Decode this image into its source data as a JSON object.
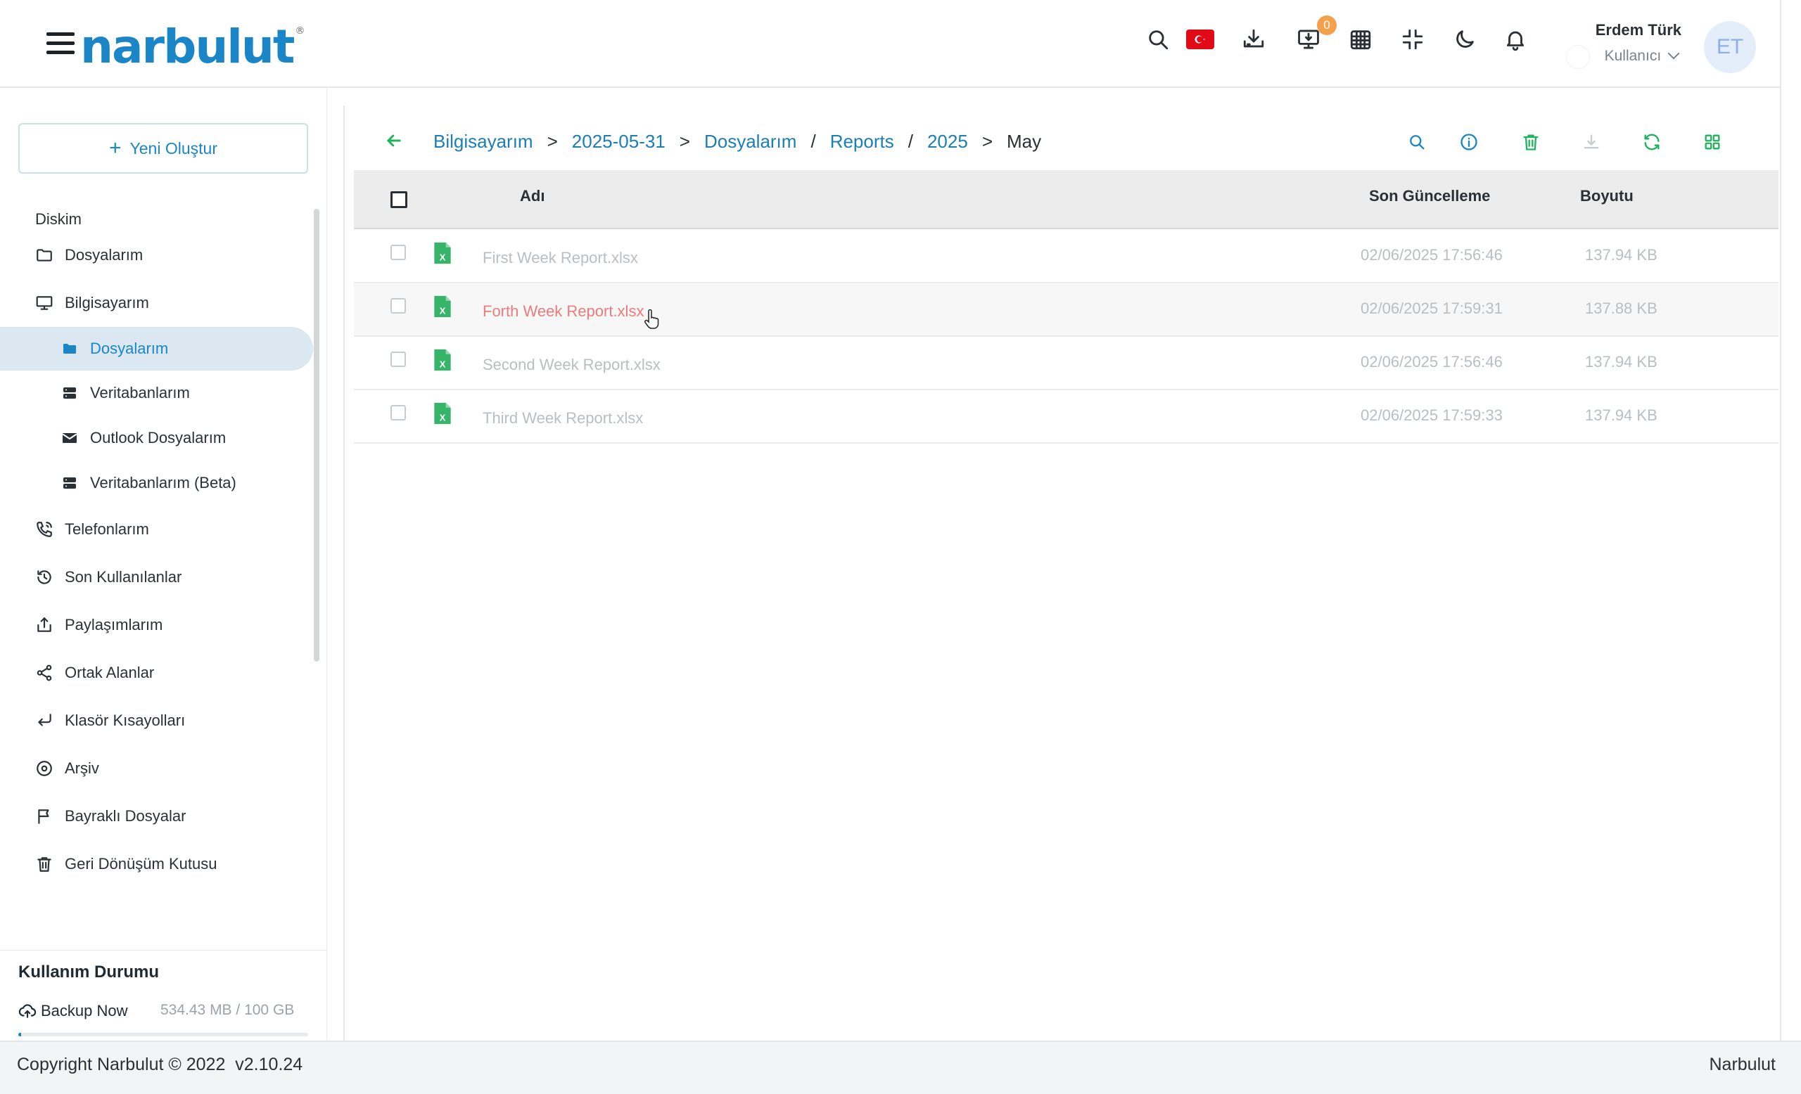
{
  "app": {
    "logo_text": "narbulut",
    "logo_mark": "®"
  },
  "header": {
    "icons": [
      "search-icon",
      "turkish-flag-icon",
      "download-icon",
      "desktop-download-icon",
      "calendar-icon",
      "collapse-icon",
      "moon-icon",
      "bell-icon"
    ],
    "download_badge": "0",
    "user": {
      "name": "Erdem Türk",
      "role": "Kullanıcı",
      "initials": "ET"
    }
  },
  "sidebar": {
    "new_button": "Yeni Oluştur",
    "section_title": "Diskim",
    "items": [
      {
        "label": "Dosyalarım",
        "icon": "folder-icon"
      },
      {
        "label": "Bilgisayarım",
        "icon": "monitor-icon"
      },
      {
        "label": "Dosyalarım",
        "icon": "folder-filled-icon",
        "active": true
      },
      {
        "label": "Veritabanlarım",
        "icon": "database-icon"
      },
      {
        "label": "Outlook Dosyalarım",
        "icon": "envelope-icon"
      },
      {
        "label": "Veritabanlarım (Beta)",
        "icon": "database-icon"
      },
      {
        "label": "Telefonlarım",
        "icon": "phone-icon"
      },
      {
        "label": "Son Kullanılanlar",
        "icon": "history-icon"
      },
      {
        "label": "Paylaşımlarım",
        "icon": "share-upload-icon"
      },
      {
        "label": "Ortak Alanlar",
        "icon": "share-nodes-icon"
      },
      {
        "label": "Klasör Kısayolları",
        "icon": "return-arrow-icon"
      },
      {
        "label": "Arşiv",
        "icon": "archive-icon"
      },
      {
        "label": "Bayraklı Dosyalar",
        "icon": "flag-icon"
      },
      {
        "label": "Geri Dönüşüm Kutusu",
        "icon": "trash-icon"
      }
    ],
    "usage": {
      "title": "Kullanım Durumu",
      "backup_label": "Backup Now",
      "used_text": "534.43 MB / 100 GB",
      "used_fraction": 0.0053
    }
  },
  "main": {
    "breadcrumb": {
      "links": [
        "Bilgisayarım",
        "2025-05-31",
        "Dosyalarım",
        "Reports",
        "2025"
      ],
      "separators": [
        ">",
        ">",
        "/",
        "/",
        ">"
      ],
      "current": "May"
    },
    "toolbar_icons": [
      "search-icon",
      "info-icon",
      "trash-icon",
      "download-icon",
      "refresh-icon",
      "grid-view-icon"
    ],
    "columns": {
      "name": "Adı",
      "modified": "Son Güncelleme",
      "size": "Boyutu"
    },
    "rows": [
      {
        "name": "First Week Report.xlsx",
        "modified": "02/06/2025 17:56:46",
        "size": "137.94 KB"
      },
      {
        "name": "Forth Week Report.xlsx",
        "modified": "02/06/2025 17:59:31",
        "size": "137.88 KB"
      },
      {
        "name": "Second Week Report.xlsx",
        "modified": "02/06/2025 17:56:46",
        "size": "137.94 KB"
      },
      {
        "name": "Third Week Report.xlsx",
        "modified": "02/06/2025 17:59:33",
        "size": "137.94 KB"
      }
    ],
    "colors": {
      "accent": "#1a86c7",
      "green": "#1fb35c",
      "hover_name": "#ec7c7c"
    }
  },
  "footer": {
    "copyright": "Copyright Narbulut © 2022",
    "version": "v2.10.24",
    "brand": "Narbulut"
  }
}
